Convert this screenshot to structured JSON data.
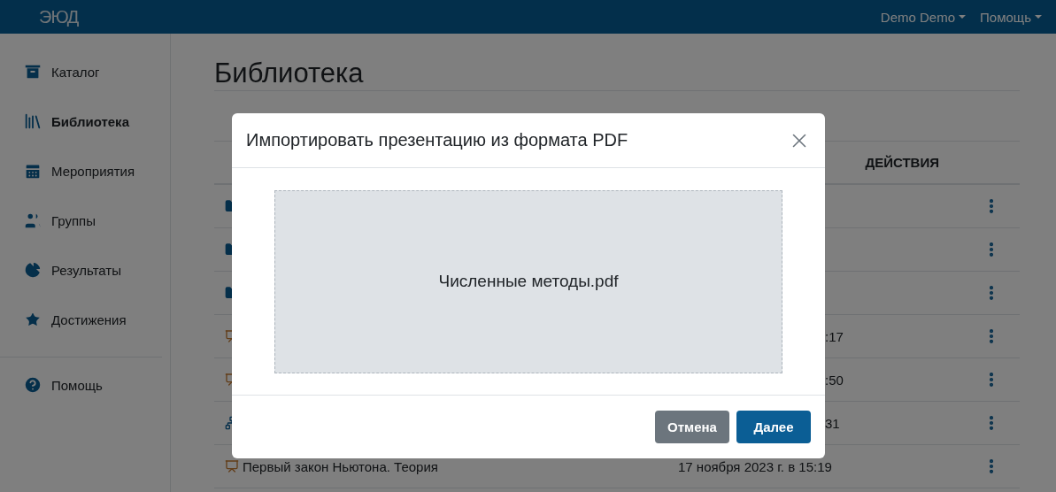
{
  "topbar": {
    "logo": "ЭЮД",
    "menus": [
      {
        "label": "Demo Demo"
      },
      {
        "label": "Помощь"
      }
    ]
  },
  "sidebar": {
    "items": [
      {
        "label": "Каталог",
        "selected": false
      },
      {
        "label": "Библиотека",
        "selected": true
      },
      {
        "label": "Мероприятия",
        "selected": false
      },
      {
        "label": "Группы",
        "selected": false
      },
      {
        "label": "Результаты",
        "selected": false
      },
      {
        "label": "Достижения",
        "selected": false
      }
    ],
    "footer_items": [
      {
        "label": "Помощь",
        "selected": false
      }
    ]
  },
  "page": {
    "title": "Библиотека",
    "table": {
      "columns": [
        "ДЕЙСТВИЯ"
      ],
      "rows": [
        {
          "kind": "folder"
        },
        {
          "kind": "folder"
        },
        {
          "kind": "folder"
        },
        {
          "kind": "presentation",
          "date": ":17"
        },
        {
          "kind": "presentation",
          "date": ":50"
        },
        {
          "kind": "network",
          "date": "31"
        },
        {
          "kind": "presentation",
          "name": "Первый закон Ньютона. Теория",
          "date": "17 ноября 2023 г. в 15:19"
        }
      ]
    }
  },
  "dialog": {
    "title": "Импортировать презентацию из формата PDF",
    "file": "Численные методы.pdf",
    "buttons": [
      {
        "label": "Отмена",
        "kind": "secondary"
      },
      {
        "label": "Далее",
        "kind": "primary"
      }
    ]
  }
}
